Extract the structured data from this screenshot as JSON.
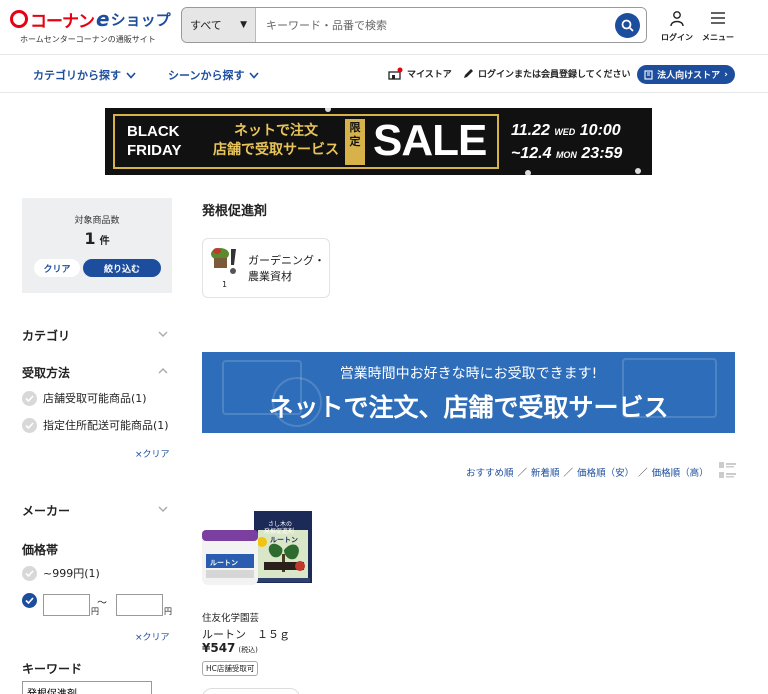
{
  "header": {
    "logo": {
      "brand": "コーナン",
      "e": "e",
      "shop": "ショップ",
      "tagline": "ホームセンターコーナンの通販サイト"
    },
    "search": {
      "category": "すべて",
      "placeholder": "キーワード・品番で検索"
    },
    "login_label": "ログイン",
    "menu_label": "メニュー"
  },
  "subnav": {
    "category_browse": "カテゴリから探す",
    "scene_browse": "シーンから探す",
    "my_store": "マイストア",
    "login_register": "ログインまたは会員登録してください",
    "corporate_store": "法人向けストア"
  },
  "banner": {
    "black": "BLACK",
    "friday": "FRIDAY",
    "jp_line1": "ネットで注文",
    "jp_line2": "店舗で受取サービス",
    "limited": "限定",
    "sale": "SALE",
    "start_date": "11.22",
    "start_day": "WED",
    "start_time": "10:00",
    "end_date": "~12.4",
    "end_day": "MON",
    "end_time": "23:59"
  },
  "sidebar": {
    "count_label": "対象商品数",
    "count_value": "1",
    "count_unit": "件",
    "clear_button": "クリア",
    "filter_button": "絞り込む",
    "category_heading": "カテゴリ",
    "receive_heading": "受取方法",
    "receive_options": [
      "店舗受取可能商品(1)",
      "指定住所配送可能商品(1)"
    ],
    "clear_link": "×クリア",
    "maker_heading": "メーカー",
    "price_heading": "価格帯",
    "price_option": "~999円(1)",
    "price_sep": "〜",
    "yen": "円",
    "keyword_heading": "キーワード",
    "keyword_value": "発根促進剤"
  },
  "main": {
    "title": "発根促進剤",
    "category_card": {
      "name": "ガーデニング・農業資材",
      "count": "1"
    },
    "promo": {
      "sub": "営業時間中お好きな時にお受取できます!",
      "big": "ネットで注文、店舗で受取サービス",
      "logo": "コーナン eショップ"
    },
    "sort_options": [
      "おすすめ順",
      "新着順",
      "価格順（安）",
      "価格順（高）"
    ],
    "product": {
      "maker": "住友化学園芸",
      "name": "ルートン　１５ｇ",
      "price": "¥547",
      "tax": "(税込)",
      "tag": "HC店舗受取可",
      "box_text_1": "さし木の",
      "box_text_2": "発根促進剤",
      "box_brand": "ルートン",
      "jar_brand": "ルートン"
    }
  },
  "colors": {
    "brand_blue": "#1d4e9e",
    "brand_red": "#e60012",
    "promo_blue": "#2e6db9",
    "gold": "#d7b24b"
  }
}
